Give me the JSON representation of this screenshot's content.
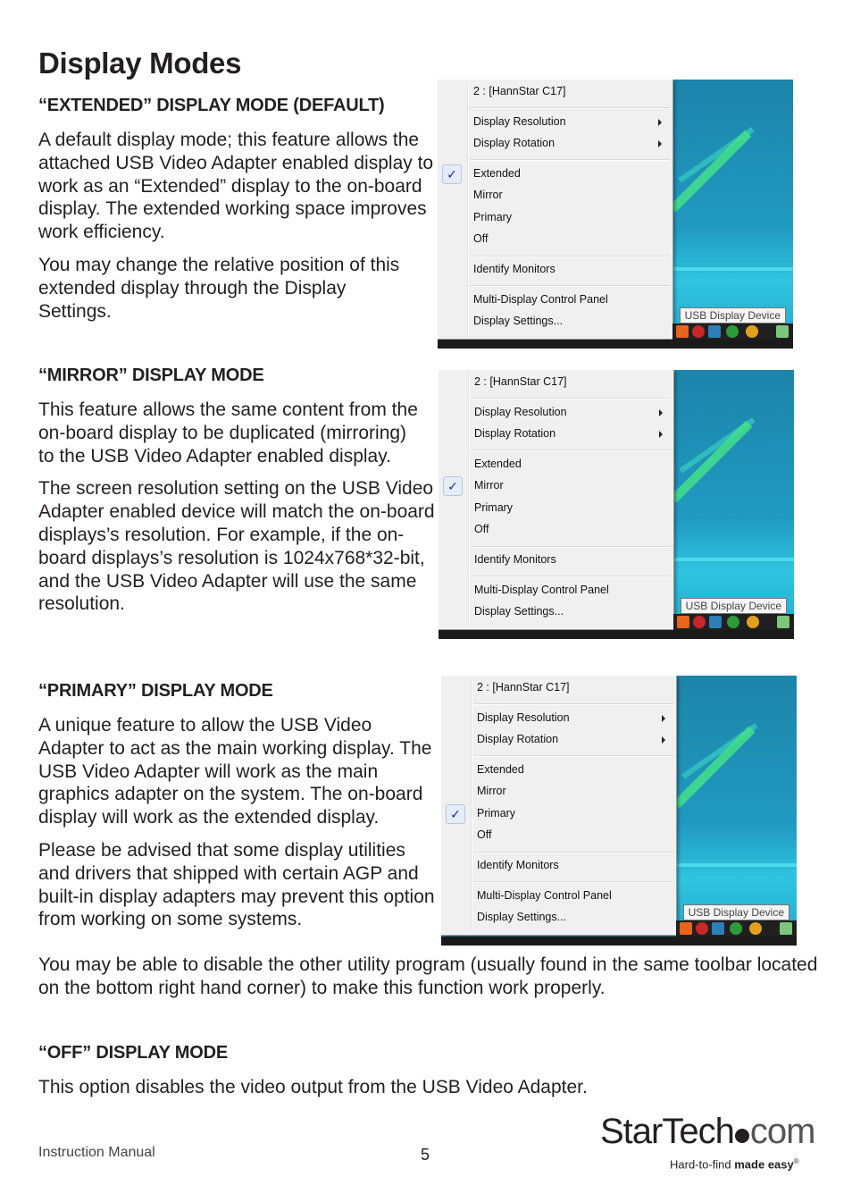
{
  "page": {
    "title": "Display Modes",
    "footer_left": "Instruction Manual",
    "page_number": "5",
    "logo": {
      "brand_main": "StarTech",
      "brand_suffix": "com",
      "tagline_regular": "Hard-to-find ",
      "tagline_bold": "made easy",
      "registered": "®"
    }
  },
  "sections": {
    "extended": {
      "heading": "“EXTENDED” DISPLAY MODE (DEFAULT)",
      "paragraphs": [
        "A default display mode; this feature allows the attached USB Video Adapter enabled display to work as an “Extended” display to the on-board display. The extended working space improves work efficiency.",
        "You may change the relative position of this extended display through the Display Settings."
      ]
    },
    "mirror": {
      "heading": "“MIRROR” DISPLAY MODE",
      "paragraphs": [
        "This feature allows the same content from the on-board display to be duplicated (mirroring) to the USB Video Adapter enabled display.",
        "The screen resolution setting on the USB Video Adapter enabled device will match the on-board displays’s resolution.  For example, if the on-board displays’s resolution is 1024x768*32-bit, and the USB Video Adapter will use the same resolution."
      ]
    },
    "primary": {
      "heading": "“PRIMARY” DISPLAY MODE",
      "paragraphs": [
        "A unique feature to allow the USB Video Adapter to act as the main working display. The USB Video Adapter will work as the main graphics adapter on the system. The on-board display will work as the extended display.",
        "Please be advised that some display utilities and drivers that shipped with certain AGP and built-in display adapters may prevent this option from working on some systems."
      ],
      "continuation": "You may be able to disable the other utility program (usually found in the same toolbar located on the bottom right hand corner) to make this function work properly."
    },
    "off": {
      "heading": "“OFF” DISPLAY MODE",
      "paragraphs": [
        "This option disables the video output from the USB Video Adapter."
      ]
    }
  },
  "menu": {
    "header": "2 : [HannStar C17]",
    "display_resolution": "Display Resolution",
    "display_rotation": "Display Rotation",
    "extended": "Extended",
    "mirror": "Mirror",
    "primary": "Primary",
    "off": "Off",
    "identify_monitors": "Identify Monitors",
    "control_panel": "Multi-Display Control Panel",
    "display_settings": "Display Settings...",
    "tooltip": "USB Display Device",
    "check_glyph": "✓"
  },
  "screenshots": [
    {
      "checked": "extended"
    },
    {
      "checked": "mirror"
    },
    {
      "checked": "primary"
    }
  ]
}
